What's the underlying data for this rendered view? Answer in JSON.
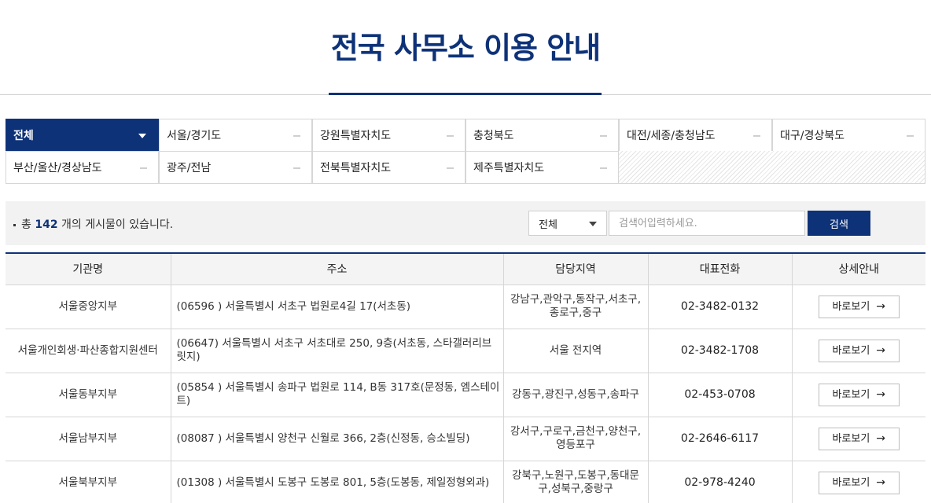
{
  "title": "전국 사무소 이용 안내",
  "tabs": [
    {
      "label": "전체",
      "active": true
    },
    {
      "label": "서울/경기도"
    },
    {
      "label": "강원특별자치도"
    },
    {
      "label": "충청북도"
    },
    {
      "label": "대전/세종/충청남도"
    },
    {
      "label": "대구/경상북도"
    },
    {
      "label": "부산/울산/경상남도"
    },
    {
      "label": "광주/전남"
    },
    {
      "label": "전북특별자치도"
    },
    {
      "label": "제주특별자치도"
    }
  ],
  "search": {
    "count_prefix": "총",
    "count": "142",
    "count_suffix": "개의 게시물이 있습니다.",
    "select_value": "전체",
    "placeholder": "검색어입력하세요.",
    "button_label": "검색"
  },
  "table": {
    "headers": [
      "기관명",
      "주소",
      "담당지역",
      "대표전화",
      "상세안내"
    ],
    "rows": [
      {
        "name": "서울중앙지부",
        "address": "(06596 ) 서울특별시 서초구 법원로4길 17(서초동)",
        "area": "강남구,관악구,동작구,서초구,종로구,중구",
        "phone": "02-3482-0132",
        "button": "바로보기"
      },
      {
        "name": "서울개인회생·파산종합지원센터",
        "address": "(06647) 서울특별시 서초구 서초대로 250, 9층(서초동, 스타갤러리브릿지)",
        "area": "서울 전지역",
        "phone": "02-3482-1708",
        "button": "바로보기"
      },
      {
        "name": "서울동부지부",
        "address": "(05854 ) 서울특별시 송파구 법원로 114, B동 317호(문정동, 엠스테이트)",
        "area": "강동구,광진구,성동구,송파구",
        "phone": "02-453-0708",
        "button": "바로보기"
      },
      {
        "name": "서울남부지부",
        "address": "(08087 ) 서울특별시 양천구 신월로 366, 2층(신정동, 승소빌딩)",
        "area": "강서구,구로구,금천구,양천구,영등포구",
        "phone": "02-2646-6117",
        "button": "바로보기"
      },
      {
        "name": "서울북부지부",
        "address": "(01308 ) 서울특별시 도봉구 도봉로 801, 5층(도봉동, 제일정형외과)",
        "area": "강북구,노원구,도봉구,동대문구,성북구,중랑구",
        "phone": "02-978-4240",
        "button": "바로보기"
      }
    ]
  }
}
